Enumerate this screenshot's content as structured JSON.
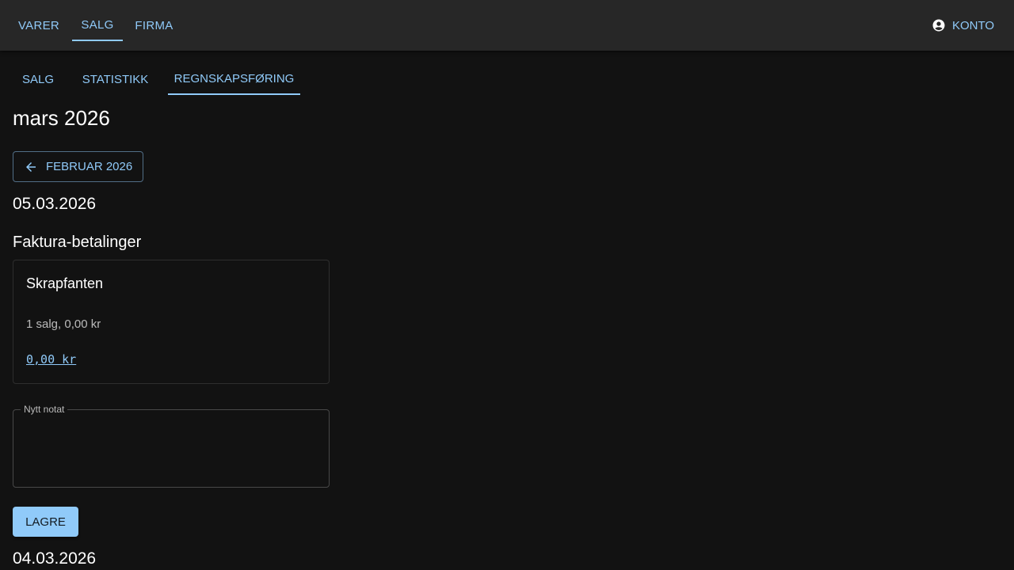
{
  "topnav": {
    "items": [
      {
        "label": "VARER"
      },
      {
        "label": "SALG"
      },
      {
        "label": "FIRMA"
      }
    ],
    "active_index": 1,
    "account_label": "KONTO"
  },
  "tabs": {
    "items": [
      {
        "label": "SALG"
      },
      {
        "label": "STATISTIKK"
      },
      {
        "label": "REGNSKAPSFØRING"
      }
    ],
    "active_index": 2
  },
  "main": {
    "month_title": "mars 2026",
    "prev_month_label": "FEBRUAR 2026",
    "days": [
      {
        "date": "05.03.2026",
        "section_title": "Faktura-betalinger",
        "payment": {
          "customer": "Skrapfanten",
          "summary": "1 salg, 0,00 kr",
          "amount": "0,00 kr"
        },
        "note_label": "Nytt notat",
        "note_value": "",
        "save_label": "LAGRE"
      },
      {
        "date": "04.03.2026"
      }
    ]
  },
  "colors": {
    "background": "#121212",
    "appbar": "#272727",
    "accent": "#90caf9"
  }
}
